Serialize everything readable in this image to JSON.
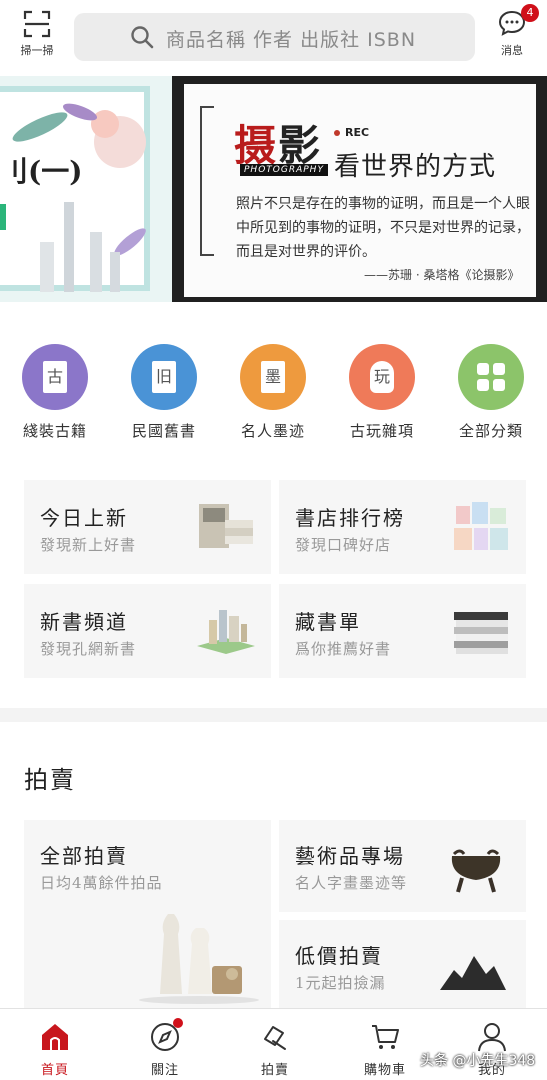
{
  "topbar": {
    "scan_label": "掃一掃",
    "search_placeholder": "商品名稱 作者 出版社 ISBN",
    "message_label": "消息",
    "message_badge": "4"
  },
  "banner": {
    "left_text": "刂(一)",
    "title": "摄影",
    "rec": "REC",
    "photography": "PHOTOGRAPHY",
    "subtitle": "看世界的方式",
    "body": "照片不只是存在的事物的证明，而且是一个人眼中所见到的事物的证明，不只是对世界的记录，而且是对世界的评价。",
    "quote": "——苏珊 · 桑塔格《论摄影》"
  },
  "categories": [
    {
      "label": "綫裝古籍",
      "glyph": "古",
      "color": "#8b76c9"
    },
    {
      "label": "民國舊書",
      "glyph": "旧",
      "color": "#4a93d6"
    },
    {
      "label": "名人墨迹",
      "glyph": "墨",
      "color": "#ee9a3e"
    },
    {
      "label": "古玩雜項",
      "glyph": "玩",
      "color": "#ef7a59"
    },
    {
      "label": "全部分類",
      "glyph": "",
      "color": "#8cc46a"
    }
  ],
  "cards": [
    {
      "title": "今日上新",
      "sub": "發現新上好書"
    },
    {
      "title": "書店排行榜",
      "sub": "發現口碑好店"
    },
    {
      "title": "新書頻道",
      "sub": "發現孔網新書"
    },
    {
      "title": "藏書單",
      "sub": "爲你推薦好書"
    }
  ],
  "auction": {
    "title": "拍賣",
    "all": {
      "title": "全部拍賣",
      "sub": "日均4萬餘件拍品"
    },
    "art": {
      "title": "藝術品專場",
      "sub": "名人字畫墨迹等"
    },
    "cheap": {
      "title": "低價拍賣",
      "sub": "1元起拍撿漏"
    }
  },
  "tabs": [
    {
      "label": "首頁",
      "icon": "home-icon",
      "active": true
    },
    {
      "label": "關注",
      "icon": "compass-icon",
      "active": false
    },
    {
      "label": "拍賣",
      "icon": "auction-icon",
      "active": false
    },
    {
      "label": "購物車",
      "icon": "cart-icon",
      "active": false
    },
    {
      "label": "我的",
      "icon": "user-icon",
      "active": false
    }
  ],
  "watermark": "头条 @小先生348"
}
